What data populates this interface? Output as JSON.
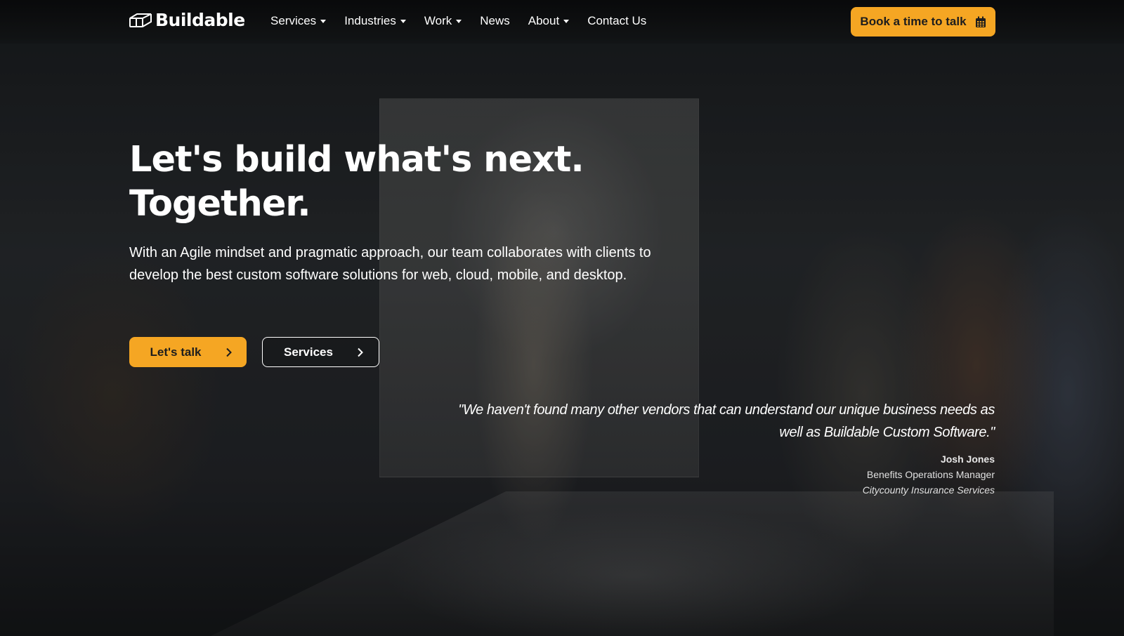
{
  "brand": {
    "name": "Buildable",
    "accent_color": "#f5a623"
  },
  "nav": {
    "items": [
      {
        "label": "Services",
        "dropdown": true
      },
      {
        "label": "Industries",
        "dropdown": true
      },
      {
        "label": "Work",
        "dropdown": true
      },
      {
        "label": "News",
        "dropdown": false
      },
      {
        "label": "About",
        "dropdown": true
      },
      {
        "label": "Contact Us",
        "dropdown": false
      }
    ],
    "cta_label": "Book a time to talk",
    "cta_icon": "calendar-icon"
  },
  "hero": {
    "headline_line1": "Let's build what's next.",
    "headline_line2": "Together.",
    "subtitle": "With an Agile mindset and pragmatic approach, our team collaborates with clients to develop the best custom software solutions for web, cloud, mobile, and desktop.",
    "primary_button": "Let's talk",
    "secondary_button": "Services"
  },
  "testimonial": {
    "quote": "\"We haven't found many other vendors that can understand our unique business needs as well as Buildable Custom Software.\"",
    "author": "Josh Jones",
    "role": "Benefits Operations Manager",
    "company": "Citycounty Insurance Services"
  }
}
